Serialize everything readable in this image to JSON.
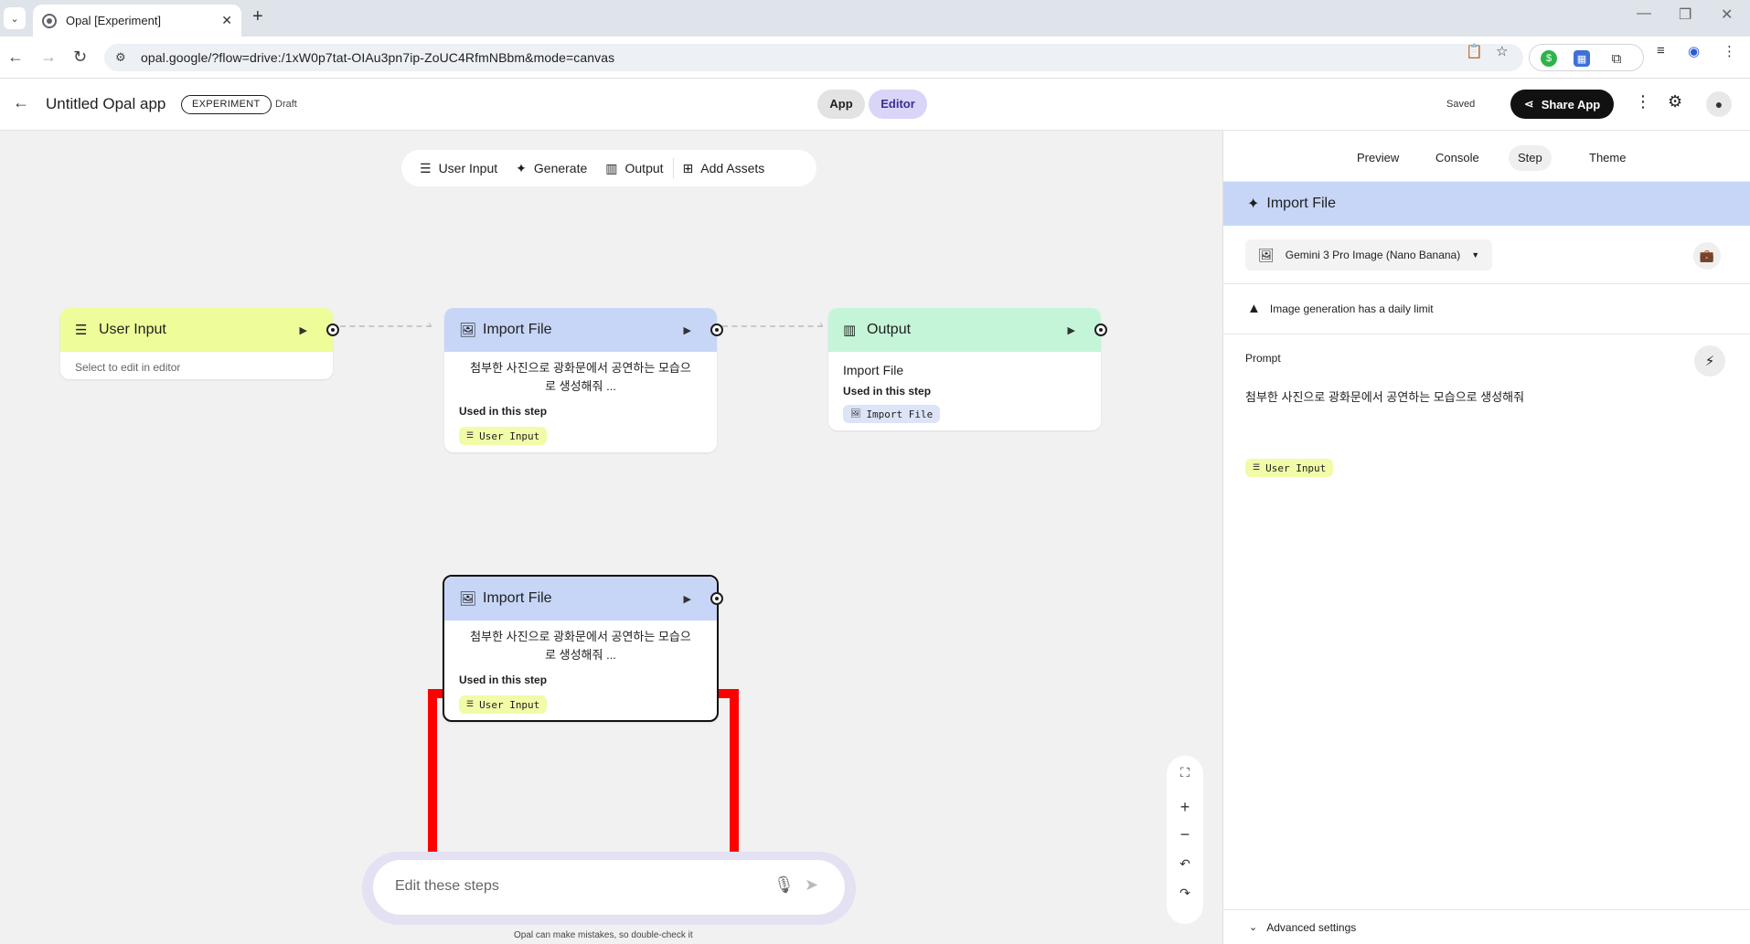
{
  "browser": {
    "tab_title": "Opal [Experiment]",
    "url": "opal.google/?flow=drive:/1xW0p7tat-OIAu3pn7ip-ZoUC4RfmNBbm&mode=canvas"
  },
  "header": {
    "title": "Untitled Opal app",
    "badge": "EXPERIMENT",
    "status": "Draft",
    "mode_app": "App",
    "mode_editor": "Editor",
    "saved": "Saved",
    "share": "Share App"
  },
  "toolbar": {
    "user_input": "User Input",
    "generate": "Generate",
    "output": "Output",
    "add_assets": "Add Assets"
  },
  "nodes": {
    "user_input": {
      "title": "User Input",
      "hint": "Select to edit in editor"
    },
    "import_file_1": {
      "title": "Import File",
      "text_line1": "첨부한 사진으로 광화문에서 공연하는 모습으",
      "text_line2": "로 생성해줘 ...",
      "used_label": "Used in this step",
      "chip": "User Input"
    },
    "output": {
      "title": "Output",
      "source": "Import File",
      "used_label": "Used in this step",
      "chip": "Import File"
    },
    "import_file_2": {
      "title": "Import File",
      "text_line1": "첨부한 사진으로 광화문에서 공연하는 모습으",
      "text_line2": "로 생성해줘 ...",
      "used_label": "Used in this step",
      "chip": "User Input"
    }
  },
  "prompt_bar": {
    "placeholder": "Edit these steps",
    "disclaimer": "Opal can make mistakes, so double-check it"
  },
  "panel": {
    "tabs": [
      "Preview",
      "Console",
      "Step",
      "Theme"
    ],
    "active_tab": "Step",
    "step_title": "Import File",
    "model": "Gemini 3 Pro Image (Nano Banana)",
    "warning": "Image generation has a daily limit",
    "prompt_label": "Prompt",
    "prompt_text": "첨부한 사진으로 광화문에서 공연하는 모습으로 생성해줘",
    "prompt_chip": "User Input",
    "advanced": "Advanced settings"
  },
  "colors": {
    "user_input_head": "#eefc9a",
    "import_head": "#c7d6f7",
    "output_head": "#c5f5d8",
    "highlight": "#ff0000"
  }
}
